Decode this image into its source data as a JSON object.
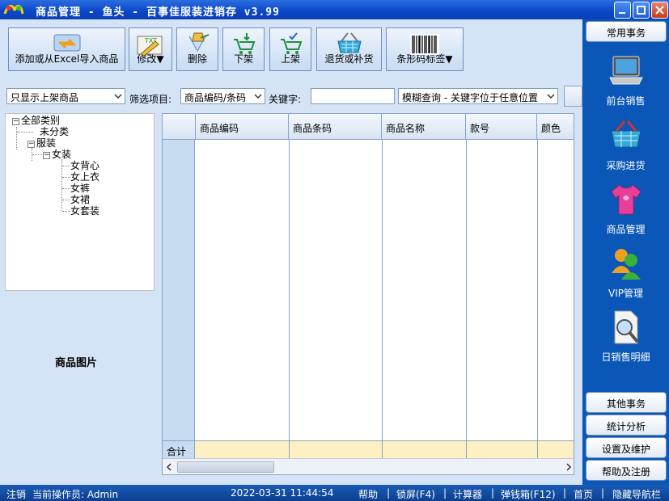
{
  "window": {
    "title": "商品管理 - 鱼头 - 百事佳服装进销存 v3.99"
  },
  "toolbar": {
    "import_label": "添加或从Excel导入商品",
    "edit_label": "修改▼",
    "delete_label": "删除",
    "unshelve_label": "下架",
    "shelve_label": "上架",
    "return_label": "退货或补货",
    "barcode_label": "条形码标签▼"
  },
  "filter": {
    "scope_value": "只显示上架商品",
    "field_label": "筛选项目:",
    "field_value": "商品编码/条码",
    "keyword_label": "关键字:",
    "keyword_value": "",
    "mode_value": "模糊查询 - 关键字位于任意位置"
  },
  "tree": {
    "root": "全部类别",
    "uncategorized": "未分类",
    "clothing": "服装",
    "women": "女装",
    "children": [
      "女背心",
      "女上衣",
      "女裤",
      "女裙",
      "女套装"
    ]
  },
  "picture_label": "商品图片",
  "grid": {
    "columns": [
      "商品编码",
      "商品条码",
      "商品名称",
      "款号",
      "颜色"
    ],
    "total_label": "合计"
  },
  "nav": {
    "common_label": "常用事务",
    "items": [
      {
        "label": "前台销售",
        "icon": "laptop-icon"
      },
      {
        "label": "采购进货",
        "icon": "basket-icon"
      },
      {
        "label": "商品管理",
        "icon": "tshirt-icon"
      },
      {
        "label": "VIP管理",
        "icon": "users-icon"
      },
      {
        "label": "日销售明细",
        "icon": "magnifier-document-icon"
      }
    ],
    "other_label": "其他事务",
    "stats_label": "统计分析",
    "settings_label": "设置及维护",
    "help_label": "帮助及注册"
  },
  "status": {
    "logout": "注销",
    "operator": "当前操作员: Admin",
    "datetime": "2022-03-31 11:44:54",
    "help": "帮助",
    "lock": "锁屏(F4)",
    "calculator": "计算器",
    "cashbox": "弹钱箱(F12)",
    "home": "首页",
    "hide_nav": "隐藏导航栏",
    "separator": "|"
  }
}
